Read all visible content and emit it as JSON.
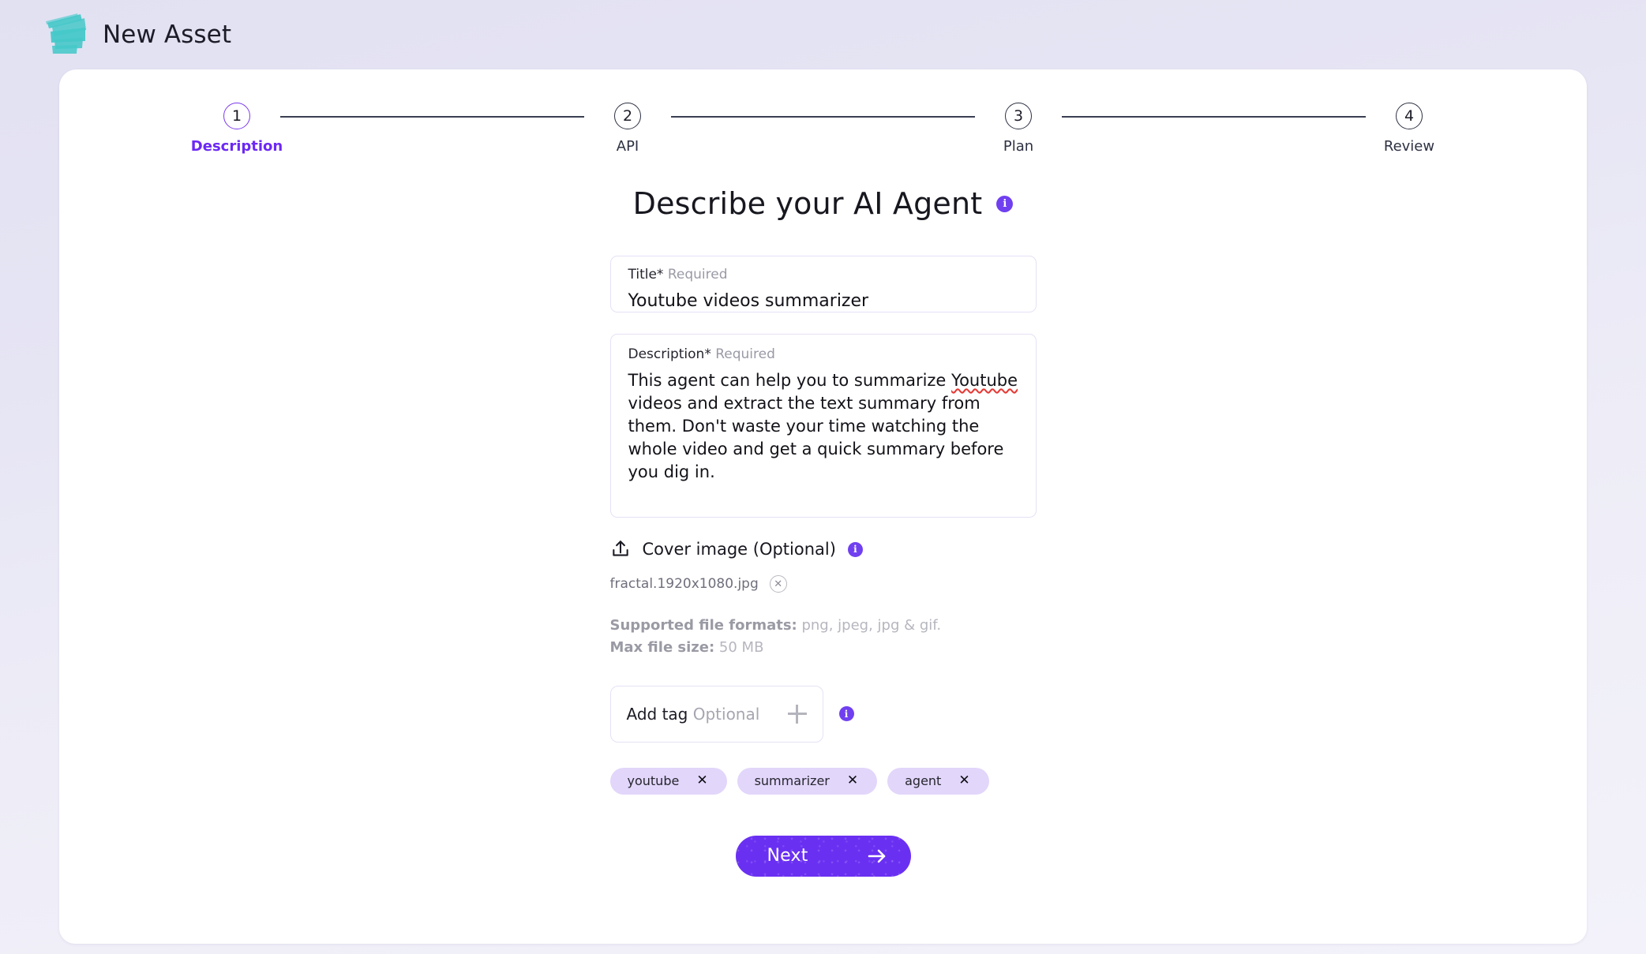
{
  "header": {
    "title": "New Asset",
    "logo_icon": "teal-brush-logo"
  },
  "stepper": {
    "steps": [
      {
        "number": "1",
        "label": "Description",
        "active": true
      },
      {
        "number": "2",
        "label": "API",
        "active": false
      },
      {
        "number": "3",
        "label": "Plan",
        "active": false
      },
      {
        "number": "4",
        "label": "Review",
        "active": false
      }
    ]
  },
  "main": {
    "heading": "Describe your AI Agent",
    "title_field": {
      "label": "Title*",
      "required_text": "Required",
      "value": "Youtube videos summarizer",
      "placeholder": "Title"
    },
    "description_field": {
      "label": "Description*",
      "required_text": "Required",
      "value_line1": "This agent can help you to summarize ",
      "value_misspelled": "Youtube",
      "value_rest": " videos and extract the text summary from them. Don't waste your time watching the whole video and get a quick summary before you dig in.",
      "placeholder": "Description"
    },
    "cover_image": {
      "label": "Cover image (Optional)",
      "upload_icon": "upload-icon",
      "file_name": "fractal.1920x1080.jpg",
      "remove_icon": "close-circle-icon",
      "supported_label": "Supported file formats:",
      "supported_value": " png, jpeg, jpg & gif.",
      "max_size_label": "Max file size:",
      "max_size_value": " 50 MB"
    },
    "tags": {
      "add_label": "Add tag",
      "add_optional": "Optional",
      "add_icon": "plus-icon",
      "placeholder": "Add tag",
      "items": [
        {
          "label": "youtube",
          "remove": "✕"
        },
        {
          "label": "summarizer",
          "remove": "✕"
        },
        {
          "label": "agent",
          "remove": "✕"
        }
      ]
    },
    "next_button": {
      "label": "Next",
      "icon": "arrow-right-icon"
    }
  },
  "colors": {
    "accent_purple": "#6a30f2",
    "step_active": "#6d28f5",
    "chip_bg": "#e2d6fb",
    "logo_teal": "#4ec8cc",
    "page_bg": "#e3e2f3"
  }
}
